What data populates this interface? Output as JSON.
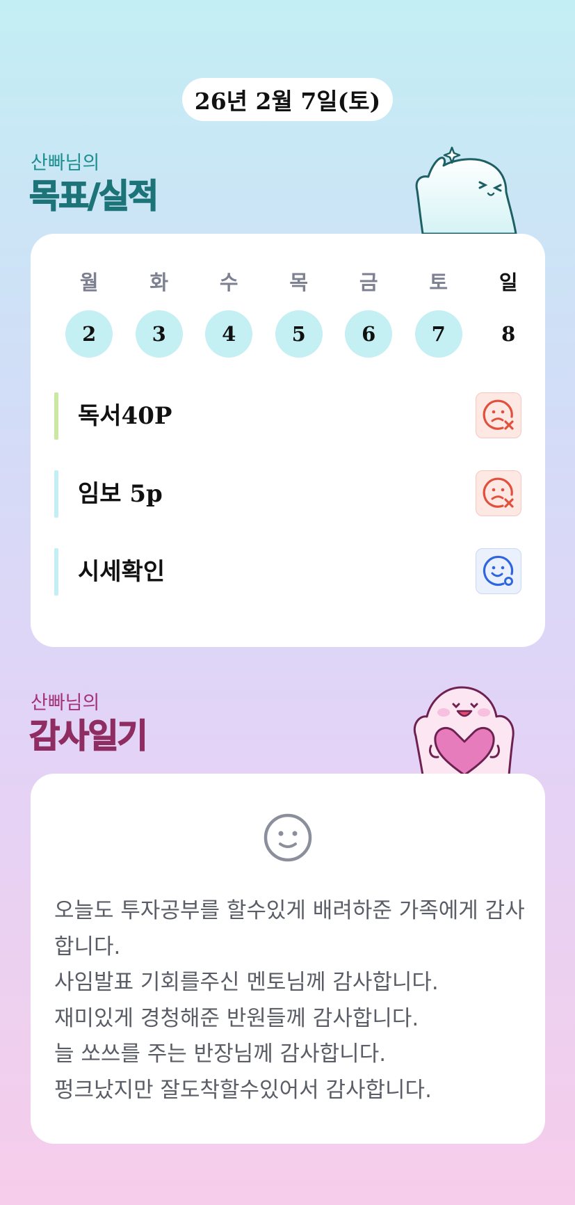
{
  "date": "26년 2월 7일(토)",
  "goals_section": {
    "owner_label": "산빠님의",
    "title": "목표/실적"
  },
  "week": {
    "days": [
      {
        "name": "월",
        "num": "2",
        "filled": true
      },
      {
        "name": "화",
        "num": "3",
        "filled": true
      },
      {
        "name": "수",
        "num": "4",
        "filled": true
      },
      {
        "name": "목",
        "num": "5",
        "filled": true
      },
      {
        "name": "금",
        "num": "6",
        "filled": true
      },
      {
        "name": "토",
        "num": "7",
        "filled": true
      },
      {
        "name": "일",
        "num": "8",
        "filled": false
      }
    ]
  },
  "goals": [
    {
      "text": "독서40P",
      "bar_color": "#cbe8a2",
      "status": "fail",
      "status_icon": "sad-face-x-icon"
    },
    {
      "text": "임보 5p",
      "bar_color": "#c3eff4",
      "status": "fail",
      "status_icon": "sad-face-x-icon"
    },
    {
      "text": "시세확인",
      "bar_color": "#c3eff4",
      "status": "ok",
      "status_icon": "happy-face-o-icon"
    }
  ],
  "gratitude_section": {
    "owner_label": "산빠님의",
    "title": "감사일기",
    "mood_icon": "smile-face-icon",
    "text": "오늘도 투자공부를 할수있게 배려하준 가족에게 감사합니다.\n사임발표 기회를주신 멘토님께 감사합니다.\n재미있게 경청해준 반원들께 감사합니다.\n늘 쏘쓰를 주는 반장님께 감사합니다.\n펑크났지만 잘도착할수있어서 감사합니다."
  },
  "colors": {
    "teal_title": "#1d7478",
    "plum_title": "#8f2d63",
    "fail_icon": "#e0503c",
    "ok_icon": "#2f66e0"
  }
}
